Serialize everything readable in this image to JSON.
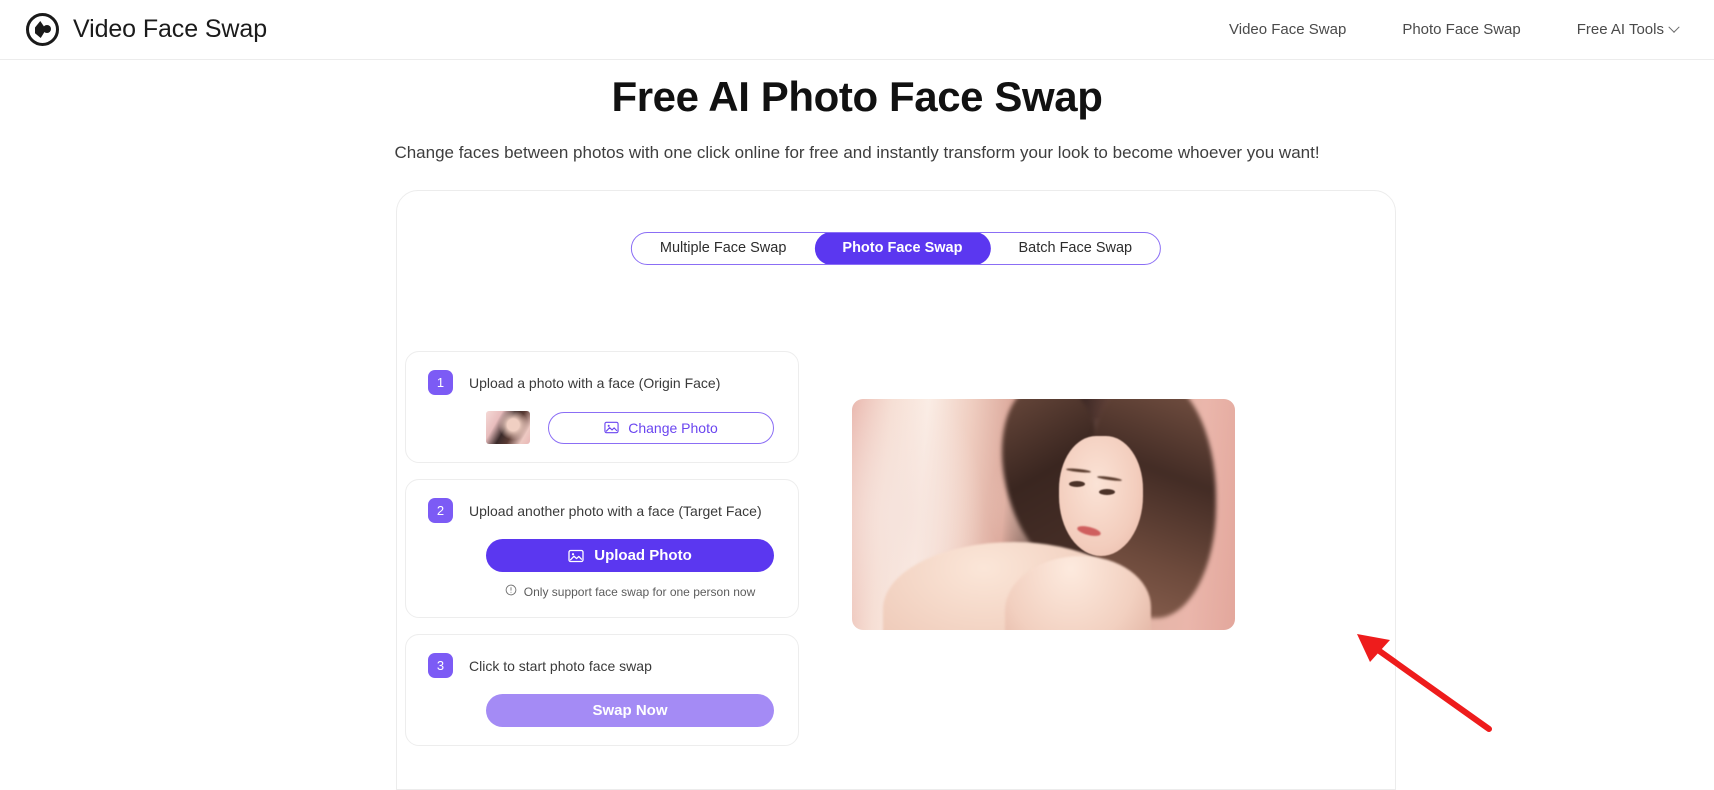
{
  "header": {
    "brand": "Video Face Swap",
    "logo_icon": "face-profile-logo-icon",
    "nav": [
      {
        "label": "Video Face Swap",
        "icon": null
      },
      {
        "label": "Photo Face Swap",
        "icon": null
      },
      {
        "label": "Free AI Tools",
        "icon": "chevron-down-icon"
      }
    ]
  },
  "hero": {
    "title": "Free AI Photo Face Swap",
    "subtitle": "Change faces between photos with one click online for free and instantly transform your look to become whoever you want!"
  },
  "tabs": [
    {
      "label": "Multiple Face Swap",
      "active": false
    },
    {
      "label": "Photo Face Swap",
      "active": true
    },
    {
      "label": "Batch Face Swap",
      "active": false
    }
  ],
  "steps": [
    {
      "number": "1",
      "label": "Upload a photo with a face  (Origin Face)",
      "thumbnail": "uploaded-origin-face-thumbnail",
      "button": {
        "label": "Change Photo",
        "icon": "image-icon",
        "style": "outline"
      },
      "note": null
    },
    {
      "number": "2",
      "label": "Upload another photo with a face  (Target Face)",
      "thumbnail": null,
      "button": {
        "label": "Upload Photo",
        "icon": "image-icon",
        "style": "solid"
      },
      "note": {
        "icon": "info-circle-icon",
        "text": "Only support face swap for one person now"
      }
    },
    {
      "number": "3",
      "label": "Click to start photo face swap",
      "thumbnail": null,
      "button": {
        "label": "Swap Now",
        "icon": null,
        "style": "solid-muted"
      },
      "note": null
    }
  ],
  "preview": {
    "alt": "origin-face-preview-photo"
  },
  "annotation": {
    "type": "red-arrow",
    "color": "#ee1c1c",
    "points_to": "preview-image-right-edge"
  },
  "colors": {
    "accent": "#5b37f0",
    "accent_light": "#a48bf5",
    "accent_badge": "#7c5bf5",
    "border": "#ececec",
    "text": "#262626",
    "annotation_red": "#ee1c1c"
  }
}
